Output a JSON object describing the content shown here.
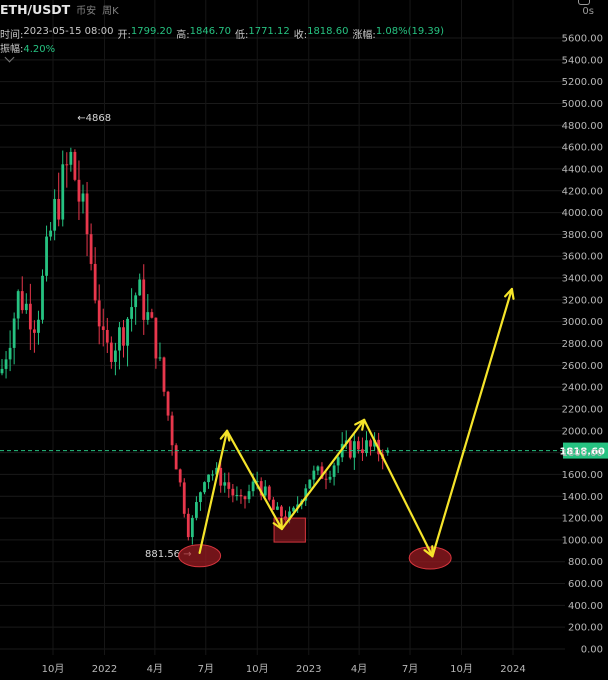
{
  "header": {
    "pair": "ETH/USDT",
    "exchange": "币安",
    "interval": "周K",
    "time_label": "时间:",
    "time_value": "2023-05-15 08:00",
    "open_label": "开:",
    "open_value": "1799.20",
    "high_label": "高:",
    "high_value": "1846.70",
    "low_label": "低:",
    "low_value": "1771.12",
    "close_label": "收:",
    "close_value": "1818.60",
    "change_label": "涨幅:",
    "change_value": "1.08%(19.39)",
    "amplitude_label": "振幅:",
    "amplitude_value": "4.20%",
    "countdown": "0s"
  },
  "colors": {
    "up": "#26c281",
    "down": "#e8374c",
    "annotation": "#f5e42a",
    "highlight": "#a31c24",
    "current_price_line": "#26c281"
  },
  "chart_data": {
    "type": "candlestick",
    "ylim": [
      0,
      5800
    ],
    "y_ticks": [
      "0.00",
      "200.00",
      "400.00",
      "600.00",
      "800.00",
      "1000.00",
      "1200.00",
      "1400.00",
      "1600.00",
      "1800.00",
      "2000.00",
      "2200.00",
      "2400.00",
      "2600.00",
      "2800.00",
      "3000.00",
      "3200.00",
      "3400.00",
      "3600.00",
      "3800.00",
      "4000.00",
      "4200.00",
      "4400.00",
      "4600.00",
      "4800.00",
      "5000.00",
      "5200.00",
      "5400.00",
      "5600.00"
    ],
    "x_ticks": [
      "10月",
      "2022",
      "4月",
      "7月",
      "10月",
      "2023",
      "4月",
      "7月",
      "10月",
      "2024"
    ],
    "current_price": "1818.60",
    "max_marker": "4868",
    "min_marker": "881.56",
    "close_path": [
      [
        "2021-05",
        2100
      ],
      [
        "2021-06",
        2300
      ],
      [
        "2021-07",
        2550
      ],
      [
        "2021-08",
        3250
      ],
      [
        "2021-09",
        3000
      ],
      [
        "2021-10",
        3950
      ],
      [
        "2021-11",
        4500
      ],
      [
        "2021-12",
        3800
      ],
      [
        "2022-01",
        2700
      ],
      [
        "2022-02",
        2900
      ],
      [
        "2022-03",
        3300
      ],
      [
        "2022-04",
        2850
      ],
      [
        "2022-05",
        1950
      ],
      [
        "2022-06",
        1050
      ],
      [
        "2022-07",
        1650
      ],
      [
        "2022-08",
        1550
      ],
      [
        "2022-09",
        1320
      ],
      [
        "2022-10",
        1550
      ],
      [
        "2022-11",
        1250
      ],
      [
        "2022-12",
        1200
      ],
      [
        "2023-01",
        1580
      ],
      [
        "2023-02",
        1620
      ],
      [
        "2023-03",
        1800
      ],
      [
        "2023-04",
        1880
      ],
      [
        "2023-05",
        1818
      ]
    ],
    "annotation_path": [
      [
        "2022-06-20",
        881
      ],
      [
        "2022-08-08",
        2000
      ],
      [
        "2022-11-14",
        1100
      ],
      [
        "2023-04-10",
        2100
      ],
      [
        "2023-08-10",
        850
      ],
      [
        "2023-12-30",
        3300
      ]
    ],
    "ellipses": [
      [
        "2022-06-20",
        900
      ],
      [
        "2023-08-06",
        880
      ]
    ],
    "highlight_box": {
      "x0": "2022-10-31",
      "x1": "2022-12-26",
      "y0": 980,
      "y1": 1200
    }
  }
}
